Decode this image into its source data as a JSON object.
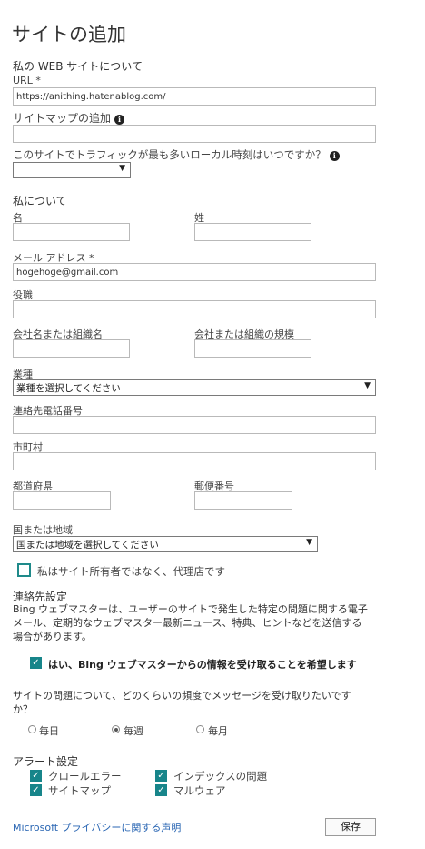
{
  "page_title": "サイトの追加",
  "website_section": {
    "heading": "私の WEB サイトについて",
    "url_label": "URL *",
    "url_value": "https://anithing.hatenablog.com/",
    "sitemap_label": "サイトマップの追加",
    "peak_time_label": "このサイトでトラフィックが最も多いローカル時刻はいつですか？",
    "peak_time_value": ""
  },
  "about_section": {
    "heading": "私について",
    "first_name_label": "名",
    "last_name_label": "姓",
    "email_label": "メール アドレス *",
    "email_value": "hogehoge@gmail.com",
    "job_title_label": "役職",
    "company_label": "会社名または組織名",
    "company_size_label": "会社または組織の規模",
    "industry_label": "業種",
    "industry_value": "業種を選択してください",
    "phone_label": "連絡先電話番号",
    "city_label": "市町村",
    "state_label": "都道府県",
    "postal_label": "郵便番号",
    "country_label": "国または地域",
    "country_value": "国または地域を選択してください",
    "agency_label": "私はサイト所有者ではなく、代理店です"
  },
  "contact_section": {
    "heading": "連絡先設定",
    "description_line1": "Bing ウェブマスターは、ユーザーのサイトで発生した特定の問題に関する電子",
    "description_line2": "メール、定期的なウェブマスター最新ニュース、特典、ヒントなどを送信する",
    "description_line3": "場合があります。",
    "opt_in_label": "はい、Bing ウェブマスターからの情報を受け取ることを希望します",
    "frequency_question_line1": "サイトの問題について、どのくらいの頻度でメッセージを受け取りたいです",
    "frequency_question_line2": "か？",
    "frequency_options": [
      "毎日",
      "毎週",
      "毎月"
    ],
    "frequency_selected": "毎週"
  },
  "alert_section": {
    "heading": "アラート設定",
    "items": [
      "クロールエラー",
      "インデックスの問題",
      "サイトマップ",
      "マルウェア"
    ]
  },
  "footer": {
    "privacy_link": "Microsoft プライバシーに関する声明",
    "save_button": "保存"
  },
  "colors": {
    "checkbox_teal": "#17858a",
    "link_blue": "#2a66b3"
  }
}
